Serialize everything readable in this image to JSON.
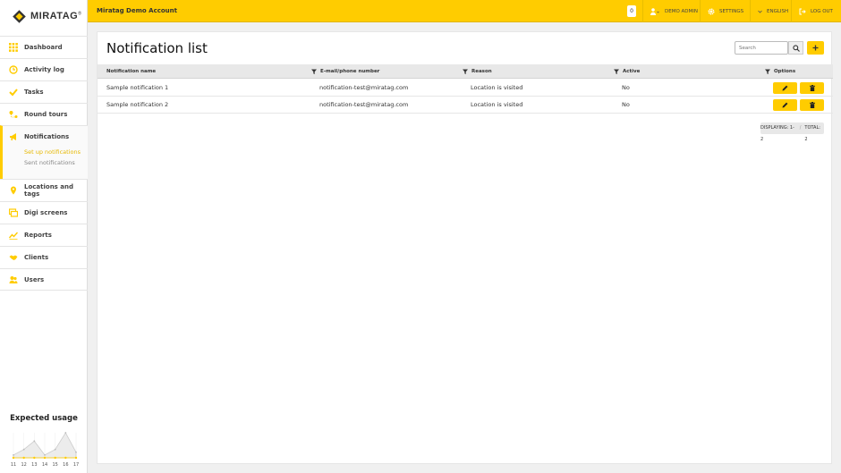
{
  "app": {
    "logo_text": "MIRATAG",
    "account_name": "Miratag Demo Account"
  },
  "topbar": {
    "notification_count": "0",
    "user_label": "DEMO ADMIN",
    "settings_label": "SETTINGS",
    "language_label": "ENGLISH",
    "logout_label": "LOG OUT"
  },
  "sidebar": {
    "items": [
      {
        "label": "Dashboard",
        "icon": "grid-icon"
      },
      {
        "label": "Activity log",
        "icon": "clock-icon"
      },
      {
        "label": "Tasks",
        "icon": "check-icon"
      },
      {
        "label": "Round tours",
        "icon": "route-icon"
      },
      {
        "label": "Notifications",
        "icon": "megaphone-icon"
      },
      {
        "label": "Locations and tags",
        "icon": "pin-icon"
      },
      {
        "label": "Digi screens",
        "icon": "screens-icon"
      },
      {
        "label": "Reports",
        "icon": "chart-icon"
      },
      {
        "label": "Clients",
        "icon": "handshake-icon"
      },
      {
        "label": "Users",
        "icon": "users-icon"
      }
    ],
    "sub_items": [
      "Set up notifications",
      "Sent notifications"
    ],
    "active_sub_item": "Set up notifications"
  },
  "usage": {
    "title": "Expected usage",
    "chart_data": {
      "type": "area",
      "x": [
        "11",
        "12",
        "13",
        "14",
        "15",
        "16",
        "17"
      ],
      "series": [
        {
          "values": [
            1,
            3,
            6,
            1,
            3,
            9,
            2
          ]
        },
        {
          "values": [
            0,
            0,
            0,
            0,
            0,
            0,
            0
          ]
        }
      ],
      "colors": [
        "#cccccc",
        "#ffcc00"
      ]
    }
  },
  "main": {
    "title": "Notification list",
    "search_placeholder": "Search",
    "columns": [
      "Notification name",
      "E-mail/phone number",
      "Reason",
      "Active",
      "Options"
    ],
    "rows": [
      {
        "name": "Sample notification 1",
        "contact": "notification-test@miratag.com",
        "reason": "Location is visited",
        "active": "No"
      },
      {
        "name": "Sample notification 2",
        "contact": "notification-test@miratag.com",
        "reason": "Location is visited",
        "active": "No"
      }
    ],
    "pager": {
      "displaying": "DISPLAYING: 1-2",
      "separator": "/",
      "total": "TOTAL: 2"
    }
  },
  "colors": {
    "accent": "#ffcc00"
  }
}
